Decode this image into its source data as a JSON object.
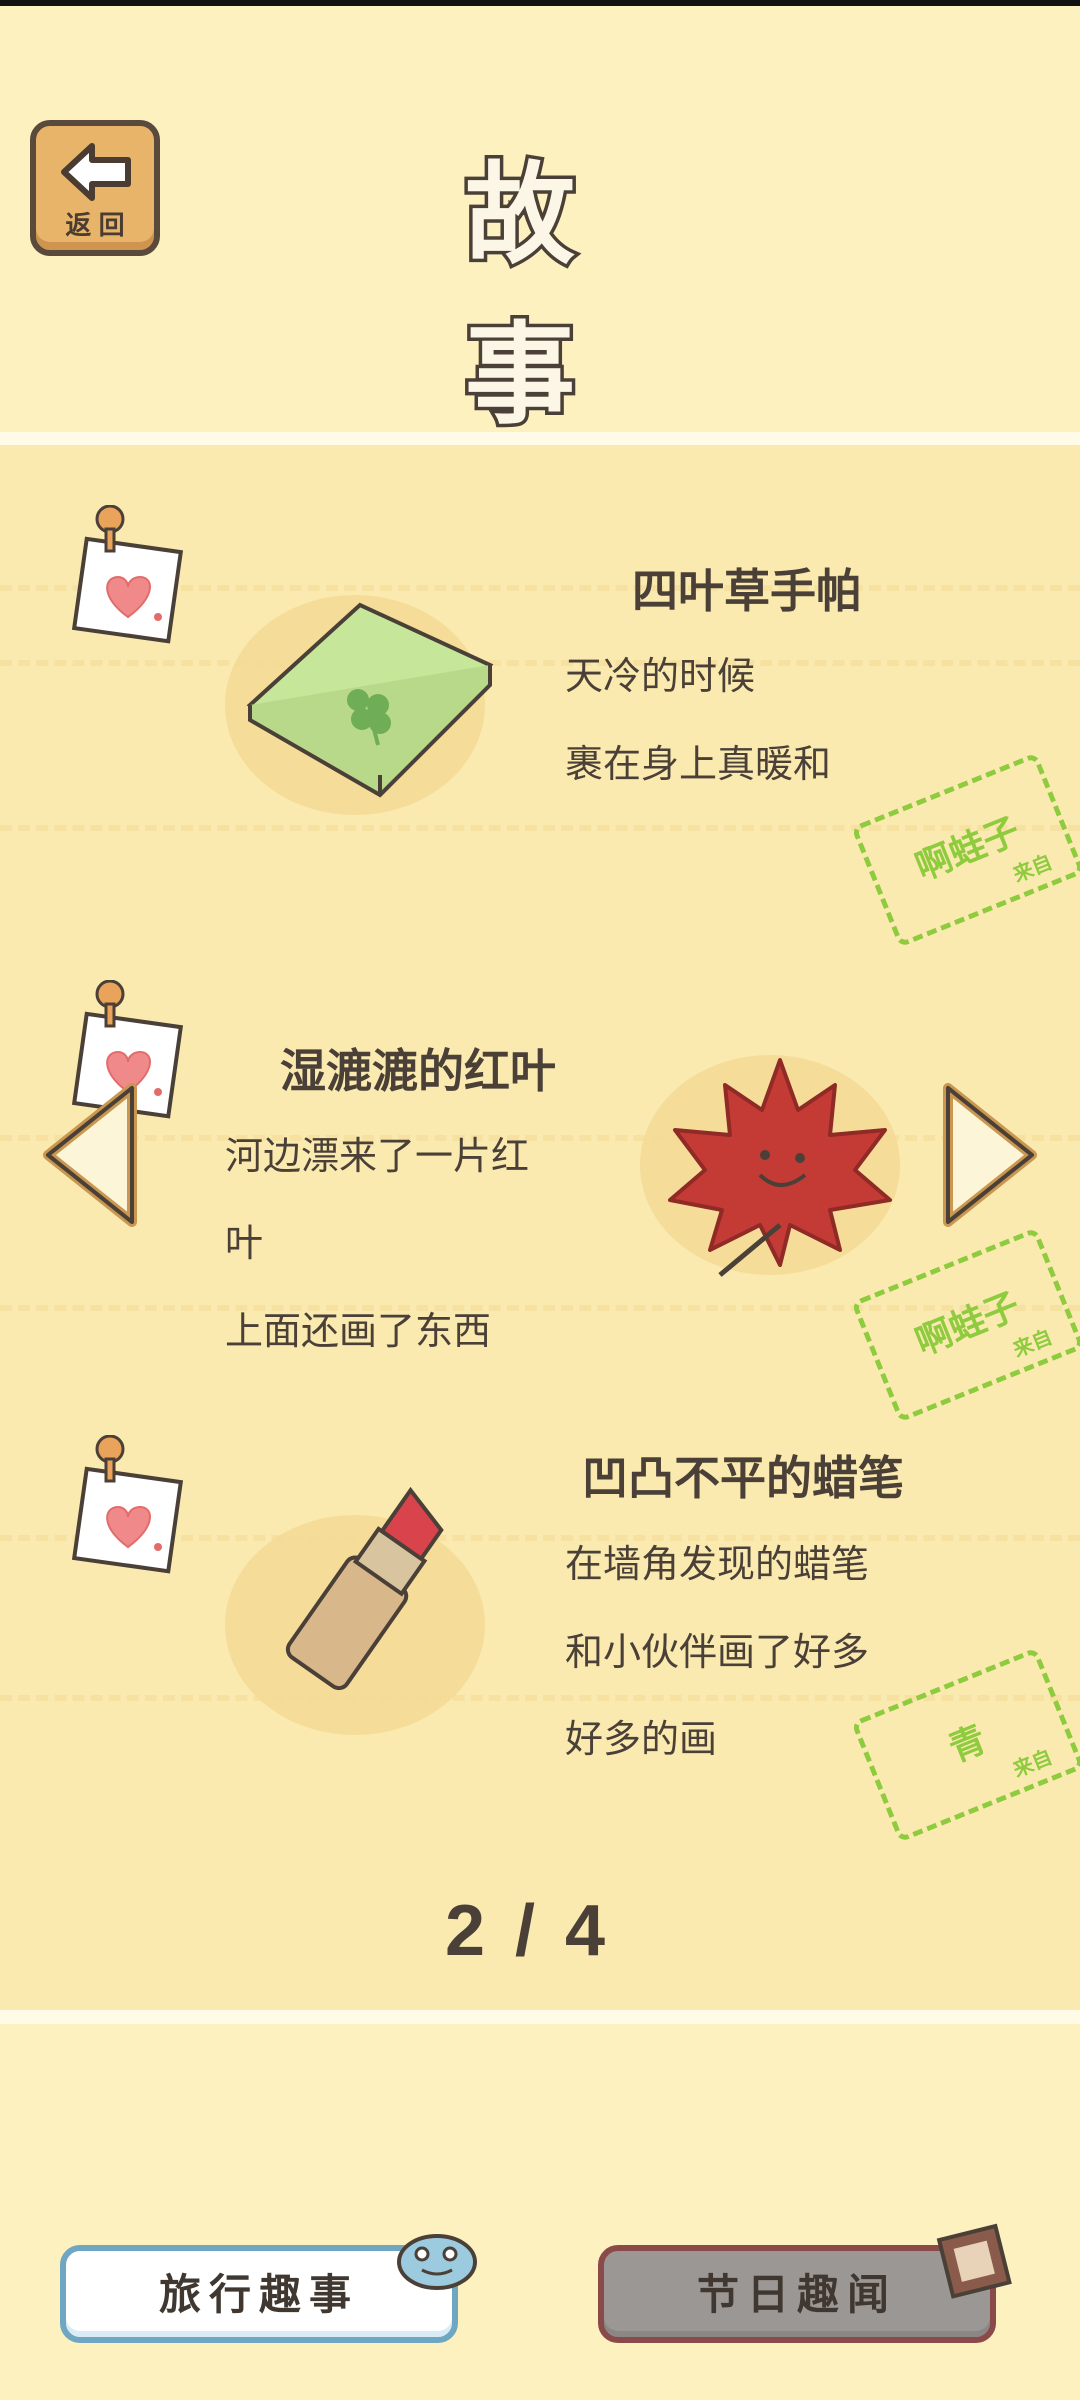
{
  "header": {
    "title": "故 事",
    "back_label": "返 回"
  },
  "stories": [
    {
      "title": "四叶草手帕",
      "lines": [
        "天冷的时候",
        "裹在身上真暖和"
      ],
      "stamp": "啊蛙子",
      "stamp_sub": "来自",
      "image_icon": "clover-handkerchief-icon"
    },
    {
      "title": "湿漉漉的红叶",
      "lines": [
        "河边漂来了一片红",
        "叶",
        "上面还画了东西"
      ],
      "stamp": "啊蛙子",
      "stamp_sub": "来自",
      "image_icon": "maple-leaf-icon"
    },
    {
      "title": "凹凸不平的蜡笔",
      "lines": [
        "在墙角发现的蜡笔",
        "和小伙伴画了好多",
        "好多的画"
      ],
      "stamp": "青",
      "stamp_sub": "来自",
      "image_icon": "crayon-icon"
    }
  ],
  "pager": {
    "current": "2",
    "separator": "/",
    "total": "4"
  },
  "tabs": {
    "travel": "旅行趣事",
    "holiday": "节日趣闻"
  },
  "colors": {
    "background": "#fdf1bf",
    "board": "#faeab0",
    "stamp": "#8fcb3e",
    "text": "#4a4037"
  }
}
